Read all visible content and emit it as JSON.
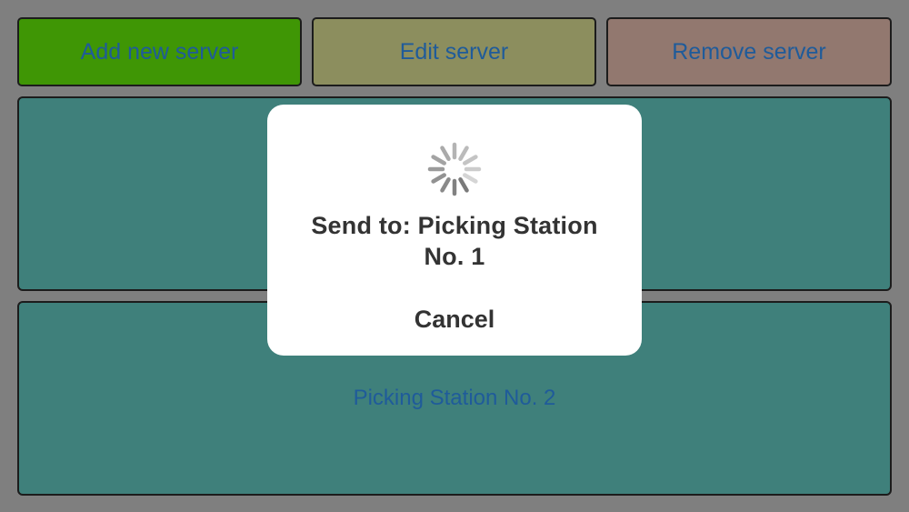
{
  "toolbar": {
    "add_label": "Add new server",
    "edit_label": "Edit server",
    "remove_label": "Remove server"
  },
  "servers": [
    {
      "label": ""
    },
    {
      "label": "Picking Station No. 2"
    }
  ],
  "dialog": {
    "title": "Send to: Picking Station No. 1",
    "cancel_label": "Cancel",
    "spinner_icon": "activity-spinner-icon"
  },
  "colors": {
    "background": "#7f7f7f",
    "add_button": "#3f9605",
    "edit_button": "#8c8e5e",
    "remove_button": "#92786f",
    "server_panel": "#3f807b",
    "button_text": "#1f5b9a",
    "dialog_background": "#ffffff",
    "dialog_text": "#333333"
  }
}
